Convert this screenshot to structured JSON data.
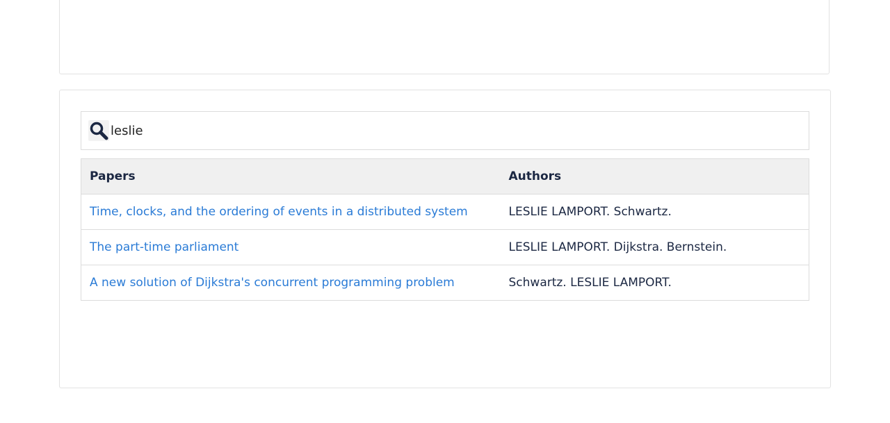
{
  "search": {
    "value": "leslie",
    "icon": "search-icon"
  },
  "table": {
    "headers": {
      "papers": "Papers",
      "authors": "Authors"
    },
    "rows": [
      {
        "paper": "Time, clocks, and the ordering of events in a distributed system",
        "authors": "LESLIE LAMPORT. Schwartz."
      },
      {
        "paper": "The part-time parliament",
        "authors": "LESLIE LAMPORT. Dijkstra. Bernstein."
      },
      {
        "paper": "A new solution of Dijkstra's concurrent programming problem",
        "authors": "Schwartz. LESLIE LAMPORT."
      }
    ]
  },
  "colors": {
    "link": "#2a7bd6",
    "text": "#1b2742",
    "icon": "#1b2742",
    "header_bg": "#f0f0f0"
  }
}
